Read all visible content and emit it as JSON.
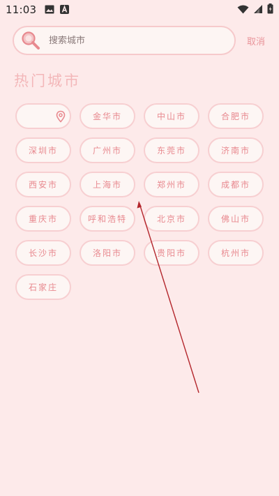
{
  "status_bar": {
    "time": "11:03",
    "left_icons": [
      "image-icon",
      "a-badge-icon"
    ],
    "right_icons": [
      "wifi-icon",
      "signal-icon",
      "battery-icon"
    ]
  },
  "search": {
    "placeholder": "搜索城市",
    "value": "",
    "cancel_label": "取消"
  },
  "hot_cities": {
    "title": "热门城市",
    "location_button": {
      "icon": "location-pin-icon",
      "label": ""
    },
    "cities": [
      "金华市",
      "中山市",
      "合肥市",
      "深圳市",
      "广州市",
      "东莞市",
      "济南市",
      "西安市",
      "上海市",
      "郑州市",
      "成都市",
      "重庆市",
      "呼和浩特",
      "北京市",
      "佛山市",
      "长沙市",
      "洛阳市",
      "贵阳市",
      "杭州市",
      "石家庄"
    ]
  },
  "colors": {
    "background": "#fdeaea",
    "accent": "#e8898f",
    "title": "#f3b7b9",
    "button_border": "#f7cfd1",
    "arrow": "#b3262c"
  }
}
